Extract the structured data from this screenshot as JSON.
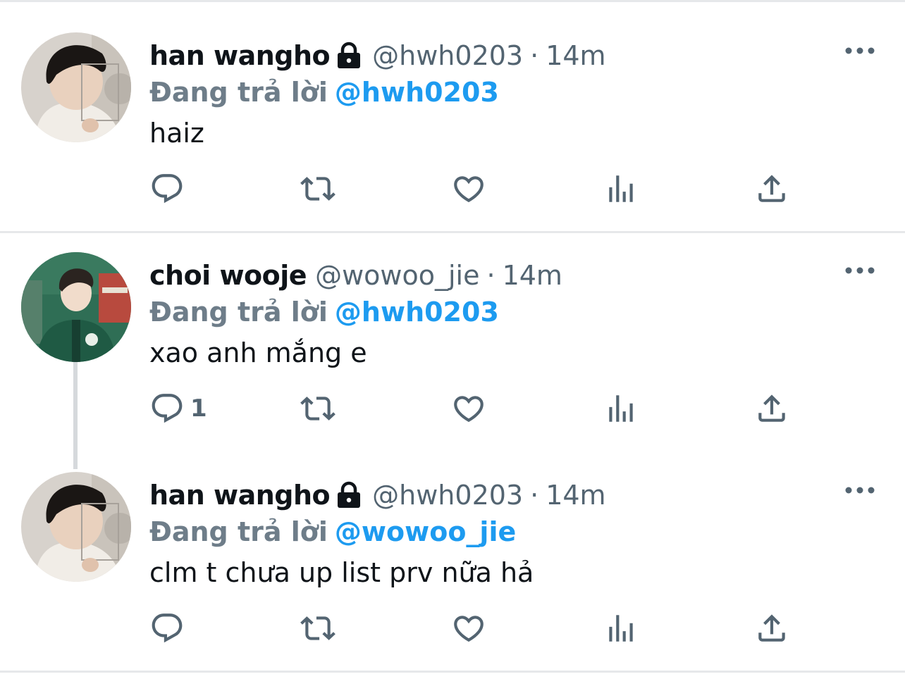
{
  "colors": {
    "link": "#1d9bf0",
    "secondary": "#536471",
    "divider": "#e6e8ea"
  },
  "tweets": [
    {
      "name": "han wangho",
      "locked": true,
      "handle": "@hwh0203",
      "separator": "·",
      "time": "14m",
      "reply_label": "Đang trả lời",
      "reply_to": "@hwh0203",
      "text": "haiz",
      "reply_count": "",
      "icons": [
        "reply-icon",
        "retweet-icon",
        "like-icon",
        "analytics-icon",
        "share-icon",
        "more-icon"
      ]
    },
    {
      "name": "choi wooje",
      "locked": false,
      "handle": "@wowoo_jie",
      "separator": "·",
      "time": "14m",
      "reply_label": "Đang trả lời",
      "reply_to": "@hwh0203",
      "text": "xao anh mắng e",
      "reply_count": "1",
      "icons": [
        "reply-icon",
        "retweet-icon",
        "like-icon",
        "analytics-icon",
        "share-icon",
        "more-icon"
      ]
    },
    {
      "name": "han wangho",
      "locked": true,
      "handle": "@hwh0203",
      "separator": "·",
      "time": "14m",
      "reply_label": "Đang trả lời",
      "reply_to": "@wowoo_jie",
      "text": "clm t chưa up list prv nữa hả",
      "reply_count": "",
      "icons": [
        "reply-icon",
        "retweet-icon",
        "like-icon",
        "analytics-icon",
        "share-icon",
        "more-icon"
      ]
    }
  ]
}
